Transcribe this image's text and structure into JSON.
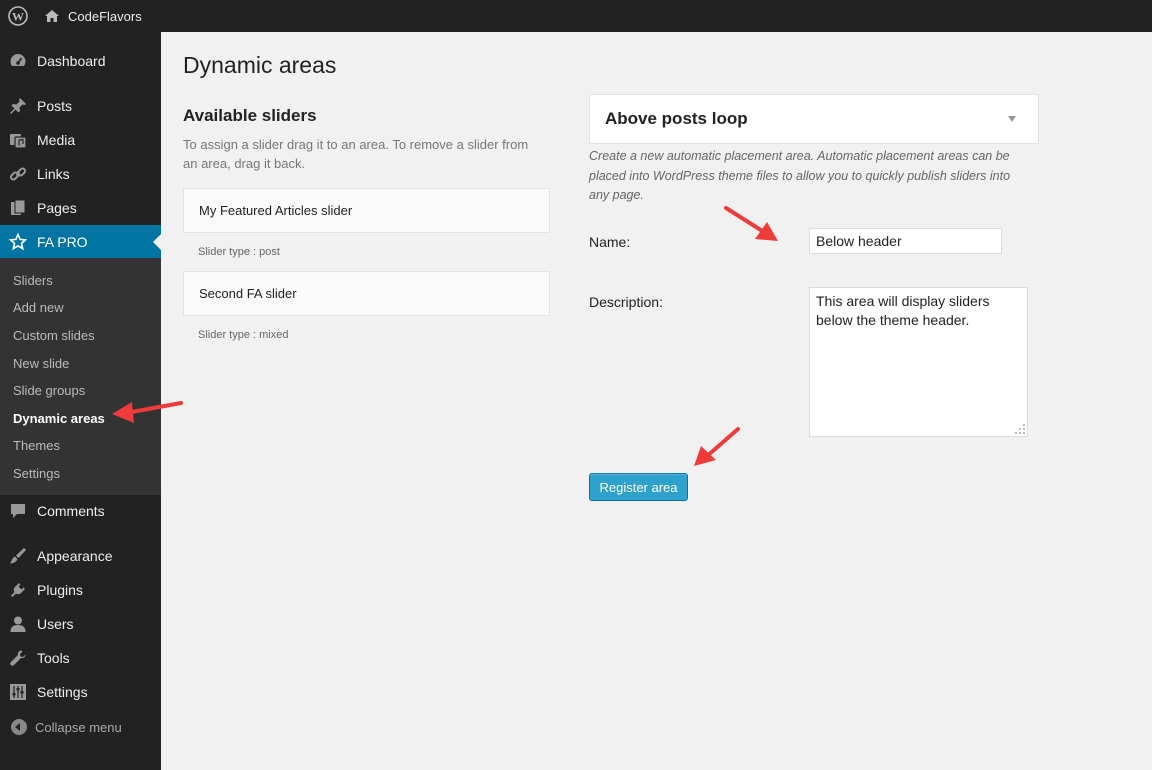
{
  "admin_bar": {
    "site_name": "CodeFlavors"
  },
  "sidebar": {
    "menu": [
      {
        "label": "Dashboard",
        "icon": "dashboard-icon"
      },
      {
        "label": "Posts",
        "icon": "pin-icon"
      },
      {
        "label": "Media",
        "icon": "media-icon"
      },
      {
        "label": "Links",
        "icon": "link-icon"
      },
      {
        "label": "Pages",
        "icon": "pages-icon"
      },
      {
        "label": "FA PRO",
        "icon": "star-icon",
        "current": true
      }
    ],
    "submenu": [
      "Sliders",
      "Add new",
      "Custom slides",
      "New slide",
      "Slide groups",
      "Dynamic areas",
      "Themes",
      "Settings"
    ],
    "submenu_current": "Dynamic areas",
    "menu_after": [
      {
        "label": "Comments",
        "icon": "comment-icon"
      },
      {
        "label": "Appearance",
        "icon": "brush-icon"
      },
      {
        "label": "Plugins",
        "icon": "plugin-icon"
      },
      {
        "label": "Users",
        "icon": "user-icon"
      },
      {
        "label": "Tools",
        "icon": "wrench-icon"
      },
      {
        "label": "Settings",
        "icon": "settings-icon"
      }
    ],
    "collapse_label": "Collapse menu"
  },
  "page": {
    "title": "Dynamic areas",
    "available": {
      "title": "Available sliders",
      "description": "To assign a slider drag it to an area. To remove a slider from an area, drag it back.",
      "sliders": [
        {
          "name": "My Featured Articles slider",
          "type": "Slider type : post"
        },
        {
          "name": "Second FA slider",
          "type": "Slider type : mixed"
        }
      ]
    },
    "area": {
      "title": "Above posts loop",
      "description": "Create a new automatic placement area. Automatic placement areas can be placed into WordPress theme files to allow you to quickly publish sliders into any page.",
      "name_label": "Name:",
      "name_value": "Below header",
      "description_label": "Description:",
      "description_value": "This area will display sliders below the theme header.",
      "register_label": "Register area"
    }
  },
  "colors": {
    "sidebar": "#222222",
    "accent": "#0074a2",
    "button": "#2ea2cc",
    "arrow": "#ef3b3b"
  }
}
